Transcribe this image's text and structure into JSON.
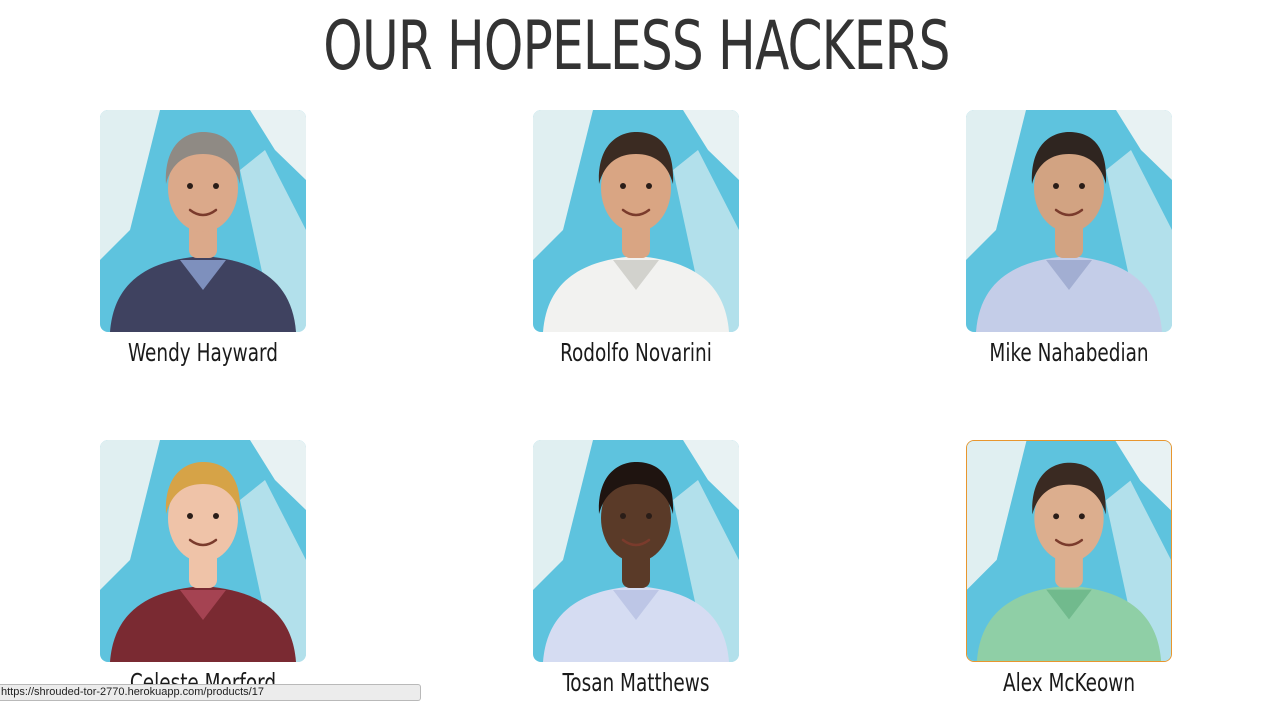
{
  "page": {
    "title": "OUR HOPELESS HACKERS"
  },
  "hackers": [
    {
      "name": "Wendy Hayward",
      "shirt": "#3f4260",
      "accent": "#8ea4d4",
      "hair": "#8f8a84",
      "skin": "#dba98a"
    },
    {
      "name": "Rodolfo Novarini",
      "shirt": "#f2f2f0",
      "accent": "#c9c9c4",
      "hair": "#3b2b22",
      "skin": "#d9a583"
    },
    {
      "name": "Mike Nahabedian",
      "shirt": "#c4cde8",
      "accent": "#9aa6cc",
      "hair": "#2f2520",
      "skin": "#d2a382"
    },
    {
      "name": "Celeste Morford",
      "shirt": "#7a2a32",
      "accent": "#b04a5a",
      "hair": "#d6a347",
      "skin": "#efc3a8"
    },
    {
      "name": "Tosan Matthews",
      "shirt": "#d5dcf2",
      "accent": "#b7c0e2",
      "hair": "#1f1410",
      "skin": "#5a3a28"
    },
    {
      "name": "Alex McKeown",
      "shirt": "#8fcfa6",
      "accent": "#69b487",
      "hair": "#3a2a22",
      "skin": "#dcae8e"
    }
  ],
  "status_bar": {
    "url": "https://shrouded-tor-2770.herokuapp.com/products/17"
  },
  "colors": {
    "photo_backdrop": "#5ec3de",
    "wall": "#f7f7f5",
    "selected_border": "#e8962e"
  }
}
